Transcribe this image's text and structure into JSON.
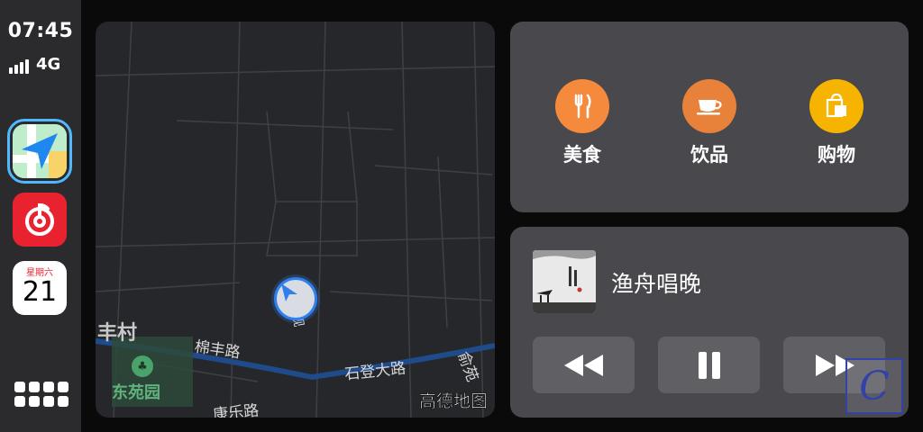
{
  "status": {
    "time": "07:45",
    "network": "4G",
    "signal_bars": 4
  },
  "dock": {
    "apps": [
      {
        "name": "maps",
        "icon": "navigation-arrow-icon",
        "selected": true
      },
      {
        "name": "music",
        "icon": "music-note-icon"
      },
      {
        "name": "calendar",
        "icon": "calendar-icon",
        "weekday": "星期六",
        "day": "21"
      }
    ],
    "home_icon": "app-grid-icon"
  },
  "map": {
    "labels": {
      "village": "丰村",
      "road_mianfeng": "棉丰路",
      "road_shideng": "石登大路",
      "road_yuyuan": "俞苑",
      "road_kangle": "康乐路",
      "road_small": "规",
      "park": "东苑园"
    },
    "attribution": "高德地图"
  },
  "poi": {
    "items": [
      {
        "label": "美食",
        "icon": "fork-knife-icon",
        "color": "#f58a3d"
      },
      {
        "label": "饮品",
        "icon": "coffee-cup-icon",
        "color": "#e8813a"
      },
      {
        "label": "购物",
        "icon": "shopping-bag-icon",
        "color": "#f6b400"
      }
    ]
  },
  "now_playing": {
    "title": "渔舟唱晚",
    "controls": [
      "rewind-icon",
      "pause-icon",
      "fast-forward-icon"
    ]
  },
  "colors": {
    "accent_blue": "#2f80ed",
    "road_main": "#1f4b8a",
    "panel": "#49484d"
  }
}
